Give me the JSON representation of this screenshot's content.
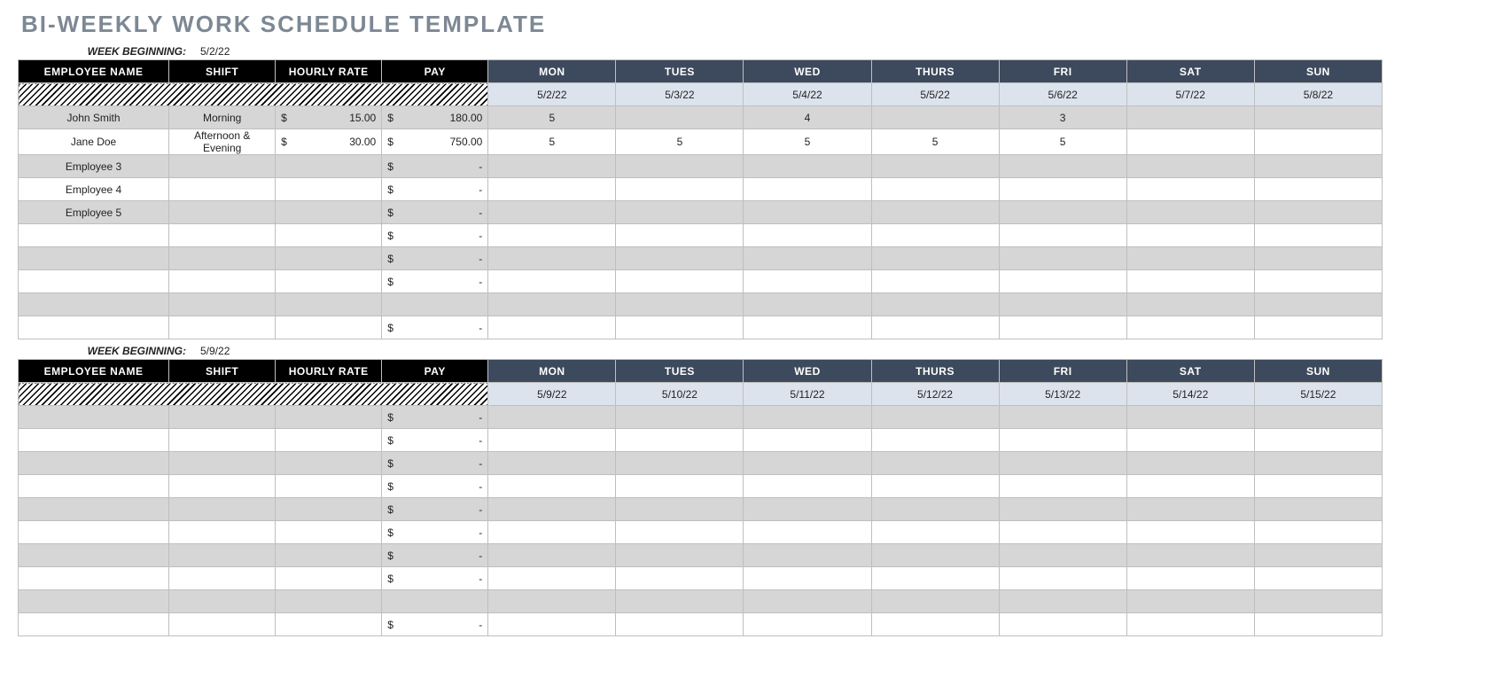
{
  "title": "BI-WEEKLY WORK SCHEDULE TEMPLATE",
  "week_beginning_label": "WEEK BEGINNING:",
  "currency_symbol": "$",
  "dash": "-",
  "columns": {
    "employee": "EMPLOYEE NAME",
    "shift": "SHIFT",
    "rate": "HOURLY RATE",
    "pay": "PAY",
    "days": [
      "MON",
      "TUES",
      "WED",
      "THURS",
      "FRI",
      "SAT",
      "SUN"
    ]
  },
  "weeks": [
    {
      "start_date": "5/2/22",
      "dates": [
        "5/2/22",
        "5/3/22",
        "5/4/22",
        "5/5/22",
        "5/6/22",
        "5/7/22",
        "5/8/22"
      ],
      "rows": [
        {
          "name": "John Smith",
          "shift": "Morning",
          "rate": "15.00",
          "pay": "180.00",
          "hours": [
            "5",
            "",
            "4",
            "",
            "3",
            "",
            ""
          ]
        },
        {
          "name": "Jane Doe",
          "shift": "Afternoon & Evening",
          "rate": "30.00",
          "pay": "750.00",
          "hours": [
            "5",
            "5",
            "5",
            "5",
            "5",
            "",
            ""
          ]
        },
        {
          "name": "Employee 3",
          "shift": "",
          "rate": "",
          "pay": "-",
          "hours": [
            "",
            "",
            "",
            "",
            "",
            "",
            ""
          ]
        },
        {
          "name": "Employee 4",
          "shift": "",
          "rate": "",
          "pay": "-",
          "hours": [
            "",
            "",
            "",
            "",
            "",
            "",
            ""
          ]
        },
        {
          "name": "Employee 5",
          "shift": "",
          "rate": "",
          "pay": "-",
          "hours": [
            "",
            "",
            "",
            "",
            "",
            "",
            ""
          ]
        },
        {
          "name": "",
          "shift": "",
          "rate": "",
          "pay": "-",
          "hours": [
            "",
            "",
            "",
            "",
            "",
            "",
            ""
          ]
        },
        {
          "name": "",
          "shift": "",
          "rate": "",
          "pay": "-",
          "hours": [
            "",
            "",
            "",
            "",
            "",
            "",
            ""
          ]
        },
        {
          "name": "",
          "shift": "",
          "rate": "",
          "pay": "-",
          "hours": [
            "",
            "",
            "",
            "",
            "",
            "",
            ""
          ]
        },
        {
          "name": "",
          "shift": "",
          "rate": "",
          "pay": "",
          "hours": [
            "",
            "",
            "",
            "",
            "",
            "",
            ""
          ]
        },
        {
          "name": "",
          "shift": "",
          "rate": "",
          "pay": "-",
          "hours": [
            "",
            "",
            "",
            "",
            "",
            "",
            ""
          ]
        }
      ]
    },
    {
      "start_date": "5/9/22",
      "dates": [
        "5/9/22",
        "5/10/22",
        "5/11/22",
        "5/12/22",
        "5/13/22",
        "5/14/22",
        "5/15/22"
      ],
      "rows": [
        {
          "name": "",
          "shift": "",
          "rate": "",
          "pay": "-",
          "hours": [
            "",
            "",
            "",
            "",
            "",
            "",
            ""
          ]
        },
        {
          "name": "",
          "shift": "",
          "rate": "",
          "pay": "-",
          "hours": [
            "",
            "",
            "",
            "",
            "",
            "",
            ""
          ]
        },
        {
          "name": "",
          "shift": "",
          "rate": "",
          "pay": "-",
          "hours": [
            "",
            "",
            "",
            "",
            "",
            "",
            ""
          ]
        },
        {
          "name": "",
          "shift": "",
          "rate": "",
          "pay": "-",
          "hours": [
            "",
            "",
            "",
            "",
            "",
            "",
            ""
          ]
        },
        {
          "name": "",
          "shift": "",
          "rate": "",
          "pay": "-",
          "hours": [
            "",
            "",
            "",
            "",
            "",
            "",
            ""
          ]
        },
        {
          "name": "",
          "shift": "",
          "rate": "",
          "pay": "-",
          "hours": [
            "",
            "",
            "",
            "",
            "",
            "",
            ""
          ]
        },
        {
          "name": "",
          "shift": "",
          "rate": "",
          "pay": "-",
          "hours": [
            "",
            "",
            "",
            "",
            "",
            "",
            ""
          ]
        },
        {
          "name": "",
          "shift": "",
          "rate": "",
          "pay": "-",
          "hours": [
            "",
            "",
            "",
            "",
            "",
            "",
            ""
          ]
        },
        {
          "name": "",
          "shift": "",
          "rate": "",
          "pay": "",
          "hours": [
            "",
            "",
            "",
            "",
            "",
            "",
            ""
          ]
        },
        {
          "name": "",
          "shift": "",
          "rate": "",
          "pay": "-",
          "hours": [
            "",
            "",
            "",
            "",
            "",
            "",
            ""
          ]
        }
      ]
    }
  ]
}
